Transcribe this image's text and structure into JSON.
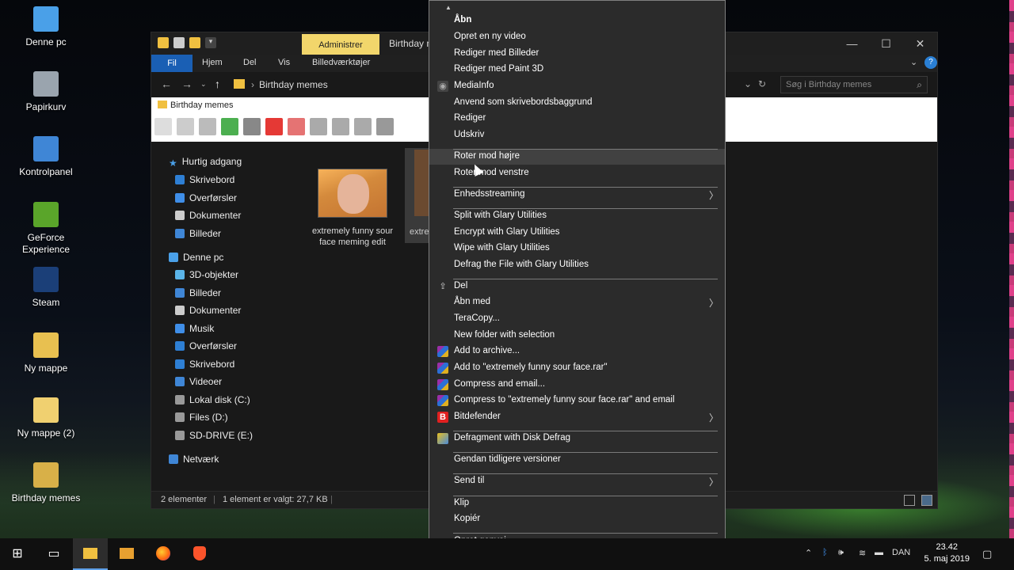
{
  "desktop": {
    "icons": [
      {
        "label": "Denne pc",
        "icon": "computer-icon",
        "color": "#4aa0e8"
      },
      {
        "label": "Papirkurv",
        "icon": "recycle-bin-icon",
        "color": "#9aa4ae"
      },
      {
        "label": "Kontrolpanel",
        "icon": "control-panel-icon",
        "color": "#3f86d6"
      },
      {
        "label": "GeForce Experience",
        "icon": "geforce-icon",
        "color": "#5aa52a"
      },
      {
        "label": "Steam",
        "icon": "steam-icon",
        "color": "#1b3f78"
      },
      {
        "label": "Ny mappe",
        "icon": "folder-icon",
        "color": "#e8c050"
      },
      {
        "label": "Ny mappe (2)",
        "icon": "folder-icon",
        "color": "#f0d070"
      },
      {
        "label": "Birthday memes",
        "icon": "folder-icon",
        "color": "#d8b048"
      }
    ]
  },
  "explorer": {
    "admin_tab": "Administrer",
    "title": "Birthday m",
    "ribbon": {
      "fil": "Fil",
      "hjem": "Hjem",
      "del": "Del",
      "vis": "Vis",
      "billed": "Billedværktøjer"
    },
    "address": {
      "crumb": "Birthday memes"
    },
    "search_placeholder": "Søg i Birthday memes",
    "folder_tab": "Birthday memes",
    "sidebar": {
      "quick_access": "Hurtig adgang",
      "quick_items": [
        "Skrivebord",
        "Overførsler",
        "Dokumenter",
        "Billeder"
      ],
      "this_pc": "Denne pc",
      "pc_items": [
        "3D-objekter",
        "Billeder",
        "Dokumenter",
        "Musik",
        "Overførsler",
        "Skrivebord",
        "Videoer",
        "Lokal disk (C:)",
        "Files (D:)",
        "SD-DRIVE (E:)"
      ],
      "network": "Netværk"
    },
    "files": [
      {
        "caption": "extremely funny sour face meming edit"
      },
      {
        "caption": "extre s"
      }
    ],
    "status": {
      "count": "2 elementer",
      "selected": "1 element er valgt: 27,7 KB"
    }
  },
  "context_menu": {
    "items": [
      {
        "label": "Åbn",
        "bold": true
      },
      {
        "label": "Opret en ny video"
      },
      {
        "label": "Rediger med Billeder"
      },
      {
        "label": "Rediger med Paint 3D"
      },
      {
        "label": "MediaInfo",
        "icon": "mediainfo-icon"
      },
      {
        "label": "Anvend som skrivebordsbaggrund"
      },
      {
        "label": "Rediger"
      },
      {
        "label": "Udskriv"
      },
      {
        "label": "Roter mod højre",
        "hover": true
      },
      {
        "label": "Roter mod venstre"
      },
      {
        "label": "Enhedsstreaming",
        "submenu": true
      },
      {
        "label": "Split with Glary Utilities"
      },
      {
        "label": "Encrypt with Glary Utilities"
      },
      {
        "label": "Wipe with Glary Utilities"
      },
      {
        "label": "Defrag the File with Glary Utilities"
      },
      {
        "label": "Del",
        "icon": "share-icon"
      },
      {
        "label": "Åbn med",
        "submenu": true
      },
      {
        "label": "TeraCopy..."
      },
      {
        "label": "New folder with selection"
      },
      {
        "label": "Add to archive...",
        "icon": "winrar-icon"
      },
      {
        "label": "Add to \"extremely funny sour face.rar\"",
        "icon": "winrar-icon"
      },
      {
        "label": "Compress and email...",
        "icon": "winrar-icon"
      },
      {
        "label": "Compress to \"extremely funny sour face.rar\" and email",
        "icon": "winrar-icon"
      },
      {
        "label": "Bitdefender",
        "icon": "bitdefender-icon",
        "submenu": true
      },
      {
        "label": "Defragment with Disk Defrag",
        "icon": "disk-defrag-icon"
      },
      {
        "label": "Gendan tidligere versioner"
      },
      {
        "label": "Send til",
        "submenu": true
      },
      {
        "label": "Klip"
      },
      {
        "label": "Kopiér"
      },
      {
        "label": "Opret genvej"
      }
    ]
  },
  "taskbar": {
    "language": "DAN",
    "time": "23.42",
    "date": "5. maj 2019"
  },
  "colors": {
    "accent": "#1a5fb4",
    "admin_tab": "#f2d66b",
    "menu_bg": "#2b2b2b",
    "menu_hover": "#414141"
  }
}
